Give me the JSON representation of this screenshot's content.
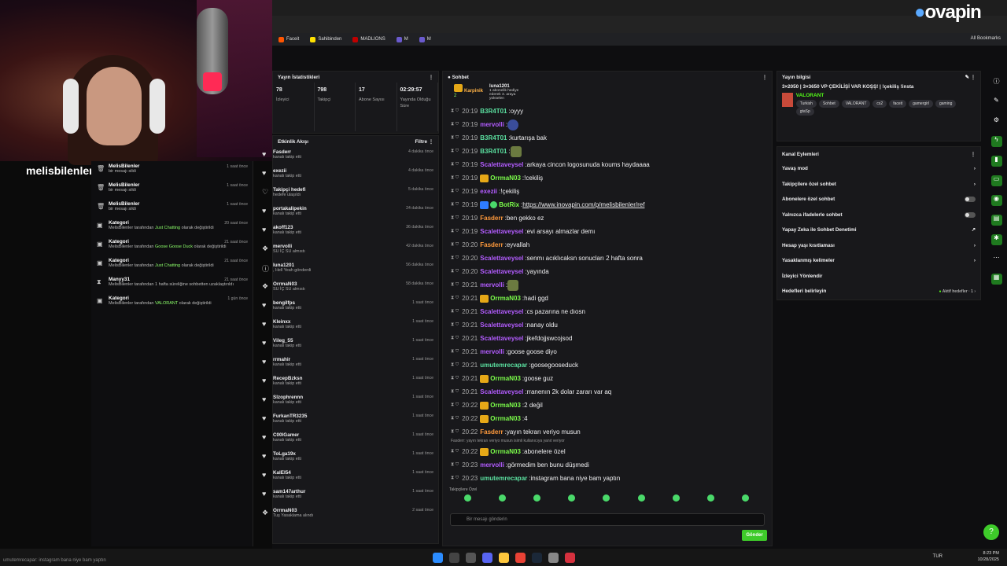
{
  "overlay": {
    "streamer_name": "melisbilenler",
    "taskbar_ticker": "umutemrecapar: instagram bana niye bam yaptın"
  },
  "browser": {
    "logo_pre": "ovapin",
    "bookmarks": [
      {
        "label": "Faceit",
        "color": "#ff5500"
      },
      {
        "label": "Sahibinden",
        "color": "#ffe100"
      },
      {
        "label": "MADLIONS",
        "color": "#c00000"
      },
      {
        "label": "M",
        "color": "#6a5acd"
      },
      {
        "label": "M",
        "color": "#6a5acd"
      }
    ],
    "all_bookmarks": "All Bookmarks"
  },
  "left_feed": [
    {
      "icon": "trash-icon",
      "name": "MelisBilenler",
      "sub": "bir mesajı sildi",
      "highlight": "",
      "sub2": "",
      "time": "1 saat önce"
    },
    {
      "icon": "trash-icon",
      "name": "MelisBilenler",
      "sub": "bir mesajı sildi",
      "highlight": "",
      "sub2": "",
      "time": "1 saat önce"
    },
    {
      "icon": "trash-icon",
      "name": "MelisBilenler",
      "sub": "bir mesajı sildi",
      "highlight": "",
      "sub2": "",
      "time": "1 saat önce"
    },
    {
      "icon": "category-icon",
      "name": "Kategori",
      "sub": "MelisBilenler tarafından ",
      "highlight": "Just Chatting",
      "sub2": " olarak değiştirildi",
      "time": "20 saat önce"
    },
    {
      "icon": "category-icon",
      "name": "Kategori",
      "sub": "MelisBilenler tarafından ",
      "highlight": "Goose Goose Duck",
      "sub2": " olarak değiştirildi",
      "time": "21 saat önce"
    },
    {
      "icon": "category-icon",
      "name": "Kategori",
      "sub": "MelisBilenler tarafından ",
      "highlight": "Just Chatting",
      "sub2": " olarak değiştirildi",
      "time": "21 saat önce"
    },
    {
      "icon": "hourglass-icon",
      "name": "Manyy31",
      "sub": "MelisBilenler tarafından 1 hafta süreliğine sohbetten uzaklaştırıldı",
      "highlight": "",
      "sub2": "",
      "time": "21 saat önce"
    },
    {
      "icon": "category-icon",
      "name": "Kategori",
      "sub": "MelisBilenler tarafından ",
      "highlight": "VALORANT",
      "sub2": " olarak değiştirildi",
      "time": "1 gün önce"
    }
  ],
  "stats": {
    "title": "Yayın İstatistikleri",
    "items": [
      {
        "value": "78",
        "label": "İzleyici"
      },
      {
        "value": "798",
        "label": "Takipçi"
      },
      {
        "value": "17",
        "label": "Abone Sayısı"
      },
      {
        "value": "02:29:57",
        "label": "Yayında Olduğu Süre"
      }
    ]
  },
  "activity": {
    "title": "Etkinlik Akışı",
    "filter": "Filtre",
    "items": [
      {
        "icon": "heart-icon",
        "name": "Fasderr",
        "sub": "kanalı takip etti",
        "time": "4 dakika önce"
      },
      {
        "icon": "heart-icon",
        "name": "exezii",
        "sub": "kanalı takip etti",
        "time": "4 dakika önce"
      },
      {
        "icon": "heart-outline-icon",
        "name": "Takipçi hedefi",
        "sub": "hedefe ulaşıldı",
        "time": "5 dakika önce"
      },
      {
        "icon": "heart-icon",
        "name": "portakalipekin",
        "sub": "kanalı takip etti",
        "time": "24 dakika önce"
      },
      {
        "icon": "heart-icon",
        "name": "akoff123",
        "sub": "kanalı takip etti",
        "time": "36 dakika önce"
      },
      {
        "icon": "gift-icon",
        "name": "mervolli",
        "sub": "SU İÇ SU almıstı",
        "time": "42 dakika önce"
      },
      {
        "icon": "info-icon",
        "name": "luna1201",
        "sub": ", Hell Yeah gönderdi",
        "time": "56 dakika önce"
      },
      {
        "icon": "gift-icon",
        "name": "OrrmaN03",
        "sub": "SU İÇ SU almıstı",
        "time": "58 dakika önce"
      },
      {
        "icon": "heart-icon",
        "name": "bengilfps",
        "sub": "kanalı takip etti",
        "time": "1 saat önce"
      },
      {
        "icon": "heart-icon",
        "name": "Kleinxx",
        "sub": "kanalı takip etti",
        "time": "1 saat önce"
      },
      {
        "icon": "heart-icon",
        "name": "Vileg_55",
        "sub": "kanalı takip etti",
        "time": "1 saat önce"
      },
      {
        "icon": "heart-icon",
        "name": "rrmahir",
        "sub": "kanalı takip etti",
        "time": "1 saat önce"
      },
      {
        "icon": "heart-icon",
        "name": "RecepBzksn",
        "sub": "kanalı takip etti",
        "time": "1 saat önce"
      },
      {
        "icon": "heart-icon",
        "name": "Slzophrennn",
        "sub": "kanalı takip etti",
        "time": "1 saat önce"
      },
      {
        "icon": "heart-icon",
        "name": "FurkanTR3235",
        "sub": "kanalı takip etti",
        "time": "1 saat önce"
      },
      {
        "icon": "heart-icon",
        "name": "C00lGamer",
        "sub": "kanalı takip etti",
        "time": "1 saat önce"
      },
      {
        "icon": "heart-icon",
        "name": "ToLga19x",
        "sub": "kanalı takip etti",
        "time": "1 saat önce"
      },
      {
        "icon": "heart-icon",
        "name": "KalEl54",
        "sub": "kanalı takip etti",
        "time": "1 saat önce"
      },
      {
        "icon": "heart-icon",
        "name": "sam147arthur",
        "sub": "kanalı takip etti",
        "time": "1 saat önce"
      },
      {
        "icon": "gift-icon",
        "name": "OrrmaN03",
        "sub": "Tuş Yasaklama alındı",
        "time": "2 saat önce"
      }
    ]
  },
  "chat": {
    "title": "Sohbet",
    "pinned_left": "Karpinik",
    "pinned_left_sub": "2",
    "pinned_right": "luna1201",
    "pinned_right_sub": "1 abonelik hediye ederek 3. araya yükselen",
    "messages": [
      {
        "time": "20:19",
        "user": "B3R4T01",
        "color": "#5be0a0",
        "text": "oyyy",
        "badge": ""
      },
      {
        "time": "20:19",
        "user": "mervolli",
        "color": "#b35cff",
        "text": "",
        "badge": "",
        "emote": "blue"
      },
      {
        "time": "20:19",
        "user": "B3R4T01",
        "color": "#5be0a0",
        "text": "kurtarışa bak",
        "badge": ""
      },
      {
        "time": "20:19",
        "user": "B3R4T01",
        "color": "#5be0a0",
        "text": "",
        "badge": "",
        "emote": "green"
      },
      {
        "time": "20:19",
        "user": "Scalettaveysel",
        "color": "#b35cff",
        "text": "arkaya cincon logosunuda koums haydaaaa",
        "badge": ""
      },
      {
        "time": "20:19",
        "user": "OrrmaN03",
        "color": "#7cff4a",
        "text": "!cekiliş",
        "badge": "gold"
      },
      {
        "time": "20:19",
        "user": "exezii",
        "color": "#b35cff",
        "text": "!çekiliş",
        "badge": ""
      },
      {
        "time": "20:19",
        "user": "BotRix",
        "color": "#7cff4a",
        "text": "https://www.inovapin.com/p/melisbilenler/ref",
        "badge": "bot",
        "link": true
      },
      {
        "time": "20:19",
        "user": "Fasderr",
        "color": "#ff9a3c",
        "text": "ben gekko ez",
        "badge": ""
      },
      {
        "time": "20:19",
        "user": "Scalettaveysel",
        "color": "#b35cff",
        "text": "evi arsayı almazlar demı",
        "badge": ""
      },
      {
        "time": "20:20",
        "user": "Fasderr",
        "color": "#ff9a3c",
        "text": "eyvallah",
        "badge": ""
      },
      {
        "time": "20:20",
        "user": "Scalettaveysel",
        "color": "#b35cff",
        "text": "senmı acıklıcaksn sonucları 2 hafta sonra",
        "badge": ""
      },
      {
        "time": "20:20",
        "user": "Scalettaveysel",
        "color": "#b35cff",
        "text": "yayında",
        "badge": ""
      },
      {
        "time": "20:21",
        "user": "mervolli",
        "color": "#b35cff",
        "text": "",
        "badge": "",
        "emote": "green"
      },
      {
        "time": "20:21",
        "user": "OrrmaN03",
        "color": "#7cff4a",
        "text": "hadi ggd",
        "badge": "gold"
      },
      {
        "time": "20:21",
        "user": "Scalettaveysel",
        "color": "#b35cff",
        "text": "cs pazarına ne dıosn",
        "badge": ""
      },
      {
        "time": "20:21",
        "user": "Scalettaveysel",
        "color": "#b35cff",
        "text": "nanay oldu",
        "badge": ""
      },
      {
        "time": "20:21",
        "user": "Scalettaveysel",
        "color": "#b35cff",
        "text": "jkefdojjswcojsod",
        "badge": ""
      },
      {
        "time": "20:21",
        "user": "mervolli",
        "color": "#b35cff",
        "text": "goose goose diyo",
        "badge": ""
      },
      {
        "time": "20:21",
        "user": "umutemrecapar",
        "color": "#5be0a0",
        "text": "goosegooseduck",
        "badge": ""
      },
      {
        "time": "20:21",
        "user": "OrrmaN03",
        "color": "#7cff4a",
        "text": "goose guz",
        "badge": "gold"
      },
      {
        "time": "20:21",
        "user": "Scalettaveysel",
        "color": "#b35cff",
        "text": "rranenın 2k dolar zararı var aq",
        "badge": ""
      },
      {
        "time": "20:22",
        "user": "OrrmaN03",
        "color": "#7cff4a",
        "text": "2 değil",
        "badge": "gold"
      },
      {
        "time": "20:22",
        "user": "OrrmaN03",
        "color": "#7cff4a",
        "text": "4",
        "badge": "gold"
      },
      {
        "time": "20:22",
        "user": "Fasderr",
        "color": "#ff9a3c",
        "text": "yayın tekrarı veriyo musun",
        "badge": ""
      }
    ],
    "reply_note": "Fasderr: yayın tekrarı veriyo musun isimli kullanıcıya yanıt veriyor",
    "messages2": [
      {
        "time": "20:22",
        "user": "OrrmaN03",
        "color": "#7cff4a",
        "text": "abonelere özel",
        "badge": "gold"
      },
      {
        "time": "20:23",
        "user": "mervolli",
        "color": "#b35cff",
        "text": "görmedim ben bunu düşmedi",
        "badge": ""
      },
      {
        "time": "20:23",
        "user": "umutemrecapar",
        "color": "#5be0a0",
        "text": "instagram bana niye bam yaptın",
        "badge": ""
      }
    ],
    "followers_only": "Takipçilere Özel",
    "input_placeholder": "Bir mesajı gönderin",
    "send_label": "Gönder"
  },
  "stream_info": {
    "title": "Yayın bilgisi",
    "stream_title": "3×2050 | 3×3650 VP ÇEKİLİŞİ VAR KOŞŞ! | !çekiliş !insta",
    "category": "VALORANT",
    "tags": [
      "Turkish",
      "Sohbet",
      "VALORANT",
      "cs2",
      "faceit",
      "gamergirl",
      "gaming",
      "gtaSp"
    ]
  },
  "channel_actions": {
    "title": "Kanal Eylemleri",
    "items": [
      {
        "label": "Yavaş mod",
        "control": "chevron"
      },
      {
        "label": "Takipçilere özel sohbet",
        "control": "chevron"
      },
      {
        "label": "Abonelere özel sohbet",
        "control": "toggle"
      },
      {
        "label": "Yalnızca ifadelerle sohbet",
        "control": "toggle"
      },
      {
        "label": "Yapay Zeka ile Sohbet Denetimi",
        "control": "external"
      },
      {
        "label": "Hesap yaşı kısıtlaması",
        "control": "chevron"
      },
      {
        "label": "Yasaklanmış kelimeler",
        "control": "chevron"
      },
      {
        "label": "İzleyici Yönlendir",
        "control": "none"
      },
      {
        "label": "Hedefleri belirleyin",
        "control": "goal"
      }
    ],
    "goal_label": "Aktif hedefler · 1"
  },
  "taskbar": {
    "lang": "TUR",
    "time": "8:23 PM",
    "date": "10/28/2025"
  },
  "colors": {
    "accent": "#53fc18",
    "bg": "#0e0e10",
    "panel": "#18181b"
  }
}
